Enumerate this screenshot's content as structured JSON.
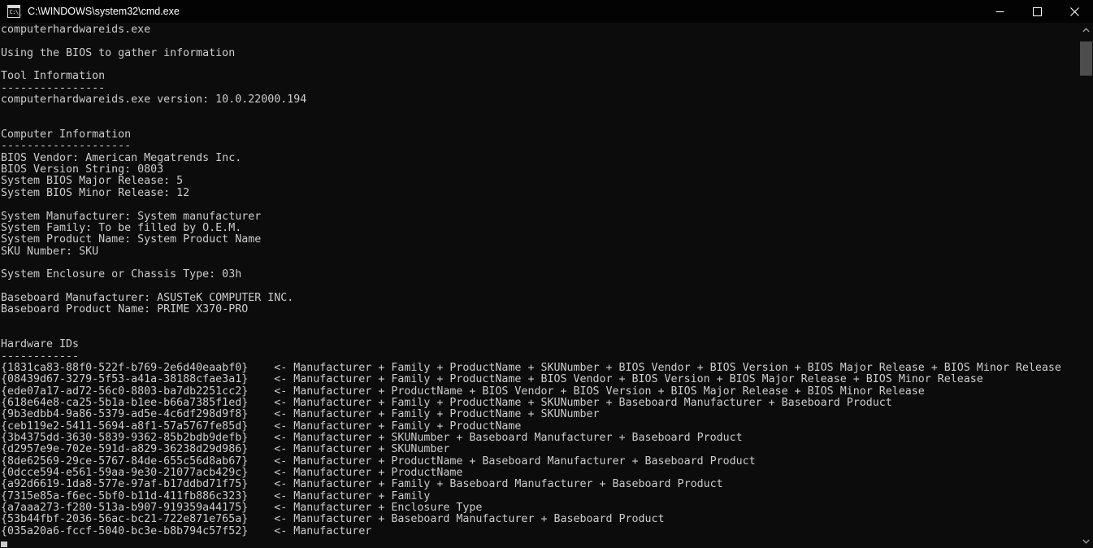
{
  "window": {
    "title": "C:\\WINDOWS\\system32\\cmd.exe",
    "icon": "cmd-console-icon",
    "icon_glyph": "C:\\_",
    "background_color": "#0c0c0c",
    "titlebar_color": "#030303",
    "text_color": "#cccccc",
    "controls": {
      "minimize": "minimize",
      "maximize": "maximize",
      "close": "close"
    }
  },
  "scrollbar": {
    "up_arrow": "scroll-up",
    "down_arrow": "scroll-down",
    "thumb_color": "#4d4d4d"
  },
  "console": {
    "program": "computerhardwareids.exe",
    "status_line": "Using the BIOS to gather information",
    "sections": {
      "tool_information": {
        "heading": "Tool Information",
        "rule": "----------------",
        "version_line": "computerhardwareids.exe version: 10.0.22000.194"
      },
      "computer_information": {
        "heading": "Computer Information",
        "rule": "--------------------",
        "bios": [
          "BIOS Vendor: American Megatrends Inc.",
          "BIOS Version String: 0803",
          "System BIOS Major Release: 5",
          "System BIOS Minor Release: 12"
        ],
        "system": [
          "System Manufacturer: System manufacturer",
          "System Family: To be filled by O.E.M.",
          "System Product Name: System Product Name",
          "SKU Number: SKU"
        ],
        "enclosure": [
          "System Enclosure or Chassis Type: 03h"
        ],
        "baseboard": [
          "Baseboard Manufacturer: ASUSTeK COMPUTER INC.",
          "Baseboard Product Name: PRIME X370-PRO"
        ]
      },
      "hardware_ids": {
        "heading": "Hardware IDs",
        "rule": "------------",
        "arrow": "<-",
        "rows": [
          {
            "guid": "{1831ca83-88f0-522f-b769-2e6d40eaabf0}",
            "components": "Manufacturer + Family + ProductName + SKUNumber + BIOS Vendor + BIOS Version + BIOS Major Release + BIOS Minor Release"
          },
          {
            "guid": "{08439d67-3279-5f53-a41a-38188cfae3a1}",
            "components": "Manufacturer + Family + ProductName + BIOS Vendor + BIOS Version + BIOS Major Release + BIOS Minor Release"
          },
          {
            "guid": "{ede07a17-ad72-56c0-8803-ba7db2251cc2}",
            "components": "Manufacturer + ProductName + BIOS Vendor + BIOS Version + BIOS Major Release + BIOS Minor Release"
          },
          {
            "guid": "{618e64e8-ca25-5b1a-b1ee-b66a7385f1ed}",
            "components": "Manufacturer + Family + ProductName + SKUNumber + Baseboard Manufacturer + Baseboard Product"
          },
          {
            "guid": "{9b3edbb4-9a86-5379-ad5e-4c6df298d9f8}",
            "components": "Manufacturer + Family + ProductName + SKUNumber"
          },
          {
            "guid": "{ceb119e2-5411-5694-a8f1-57a5767fe85d}",
            "components": "Manufacturer + Family + ProductName"
          },
          {
            "guid": "{3b4375dd-3630-5839-9362-85b2bdb9defb}",
            "components": "Manufacturer + SKUNumber + Baseboard Manufacturer + Baseboard Product"
          },
          {
            "guid": "{d2957e9e-702e-591d-a829-36238d29d986}",
            "components": "Manufacturer + SKUNumber"
          },
          {
            "guid": "{8de62569-29ce-5767-84de-655c56d8ab67}",
            "components": "Manufacturer + ProductName + Baseboard Manufacturer + Baseboard Product"
          },
          {
            "guid": "{0dcce594-e561-59aa-9e30-21077acb429c}",
            "components": "Manufacturer + ProductName"
          },
          {
            "guid": "{a92d6619-1da8-577e-97af-b17ddbd71f75}",
            "components": "Manufacturer + Family + Baseboard Manufacturer + Baseboard Product"
          },
          {
            "guid": "{7315e85a-f6ec-5bf0-b11d-411fb886c323}",
            "components": "Manufacturer + Family"
          },
          {
            "guid": "{a7aaa273-f280-513a-b907-919359a44175}",
            "components": "Manufacturer + Enclosure Type"
          },
          {
            "guid": "{53b44fbf-2036-56ac-bc21-722e871e765a}",
            "components": "Manufacturer + Baseboard Manufacturer + Baseboard Product"
          },
          {
            "guid": "{035a20a6-fccf-5040-bc3e-b8b794c57f52}",
            "components": "Manufacturer"
          }
        ]
      }
    }
  }
}
